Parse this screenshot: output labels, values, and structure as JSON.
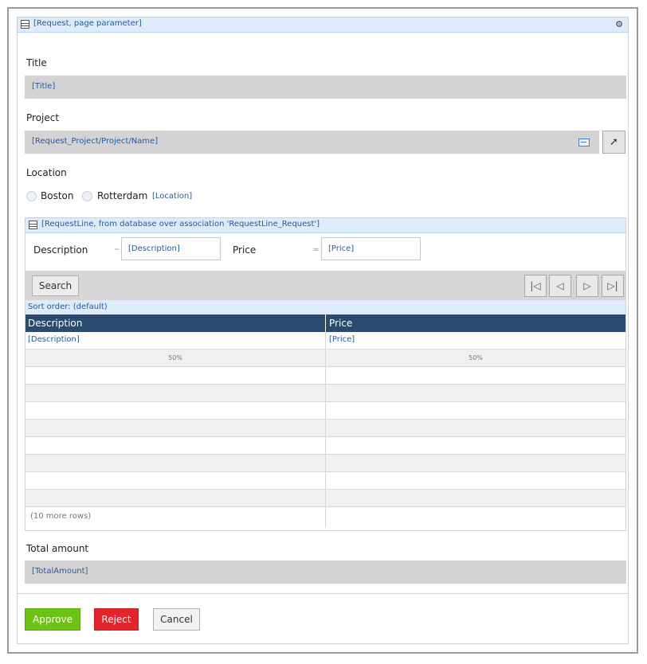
{
  "dataview": {
    "header": "[Request, page parameter]"
  },
  "title": {
    "label": "Title",
    "value": "[Title]"
  },
  "project": {
    "label": "Project",
    "value": "[Request_Project/Project/Name]",
    "button_icon": "arrow-up-right-icon"
  },
  "location": {
    "label": "Location",
    "options": [
      "Boston",
      "Rotterdam"
    ],
    "tag": "[Location]"
  },
  "grid": {
    "header": "[RequestLine, from database over association 'RequestLine_Request']",
    "search_fields": [
      {
        "label": "Description",
        "op": "~",
        "value": "[Description]"
      },
      {
        "label": "Price",
        "op": "=",
        "value": "[Price]"
      }
    ],
    "search_button": "Search",
    "pager": [
      "|◁",
      "◁",
      "▷",
      "▷|"
    ],
    "sort_order": "Sort order: (default)",
    "columns": [
      "Description",
      "Price"
    ],
    "first_row": [
      "[Description]",
      "[Price]"
    ],
    "widths": [
      "50%",
      "50%"
    ],
    "more_rows": "(10 more rows)"
  },
  "total": {
    "label": "Total amount",
    "value": "[TotalAmount]"
  },
  "buttons": {
    "approve": "Approve",
    "reject": "Reject",
    "cancel": "Cancel"
  },
  "colors": {
    "header_bg": "#2a4a6e",
    "approve": "#6cc217",
    "reject": "#e3242b",
    "link": "#2459a8"
  }
}
